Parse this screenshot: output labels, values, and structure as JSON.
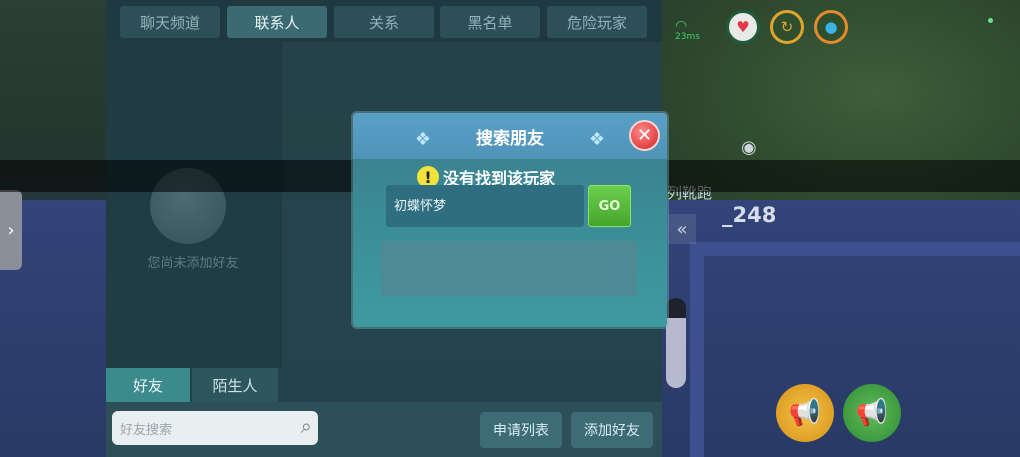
{
  "tabs": [
    {
      "label": "聊天频道",
      "active": false
    },
    {
      "label": "联系人",
      "active": true
    },
    {
      "label": "关系",
      "active": false
    },
    {
      "label": "黑名单",
      "active": false
    },
    {
      "label": "危险玩家",
      "active": false
    }
  ],
  "left_panel": {
    "empty_text": "您尚未添加好友",
    "subtabs": [
      {
        "label": "好友",
        "active": true
      },
      {
        "label": "陌生人",
        "active": false
      }
    ],
    "search_placeholder": "好友搜索"
  },
  "bottom_buttons": {
    "apply_list": "申请列表",
    "add_friend": "添加好友"
  },
  "dialog": {
    "title": "搜索朋友",
    "close_icon": "close-x-icon",
    "input_value": "初蝶怀梦",
    "go_label": "GO"
  },
  "toast": {
    "icon": "warning-icon",
    "message": "没有找到该玩家"
  },
  "hud": {
    "signal_text": "23ms",
    "icons": [
      "heart-icon",
      "refresh-icon",
      "drop-icon"
    ],
    "player_name_line1": "列靴跑",
    "player_name_line2": "_248"
  },
  "colors": {
    "panel": "#25434a",
    "accent": "#3b6a73",
    "go_button": "#43a62c",
    "close_button": "#d32424",
    "warning": "#f3e23b"
  }
}
